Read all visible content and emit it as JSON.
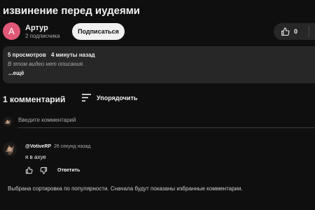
{
  "video": {
    "title": "извинение перед иудеями"
  },
  "channel": {
    "avatar_letter": "А",
    "avatar_color": "#e05877",
    "name": "Артур",
    "subscribers": "2 подписчика",
    "subscribe_label": "Подписаться"
  },
  "actions": {
    "like_count": "0"
  },
  "description": {
    "views": "5 просмотров",
    "time": "4 минуты назад",
    "empty_text": "В этом видео нет описания.",
    "more_label": "...ещё"
  },
  "comments": {
    "count_label": "1 комментарий",
    "sort_label": "Упорядочить",
    "add_placeholder": "Введите комментарий",
    "items": [
      {
        "author": "@VotiveRP",
        "time": "26 секунд назад",
        "text": "я в ахуе",
        "reply_label": "Ответить"
      }
    ],
    "sort_notice": "Выбрана сортировка по популярности. Сначала будут показаны избранные комментарии."
  },
  "colors": {
    "background": "#0f0f0f",
    "panel": "#272727",
    "accent_text": "#f1f1f1",
    "muted_text": "#aaaaaa"
  }
}
